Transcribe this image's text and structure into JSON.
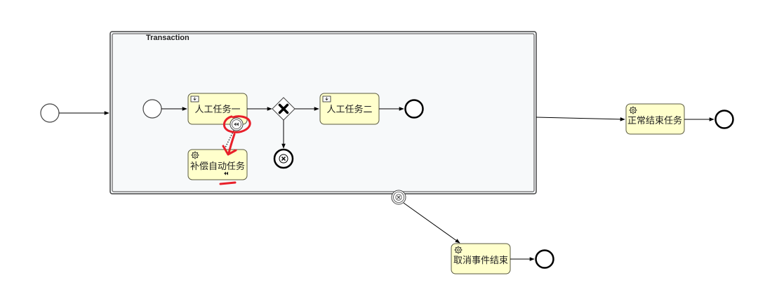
{
  "diagram": {
    "transaction_label": "Transaction",
    "tasks": {
      "user_task_1": "人工任务一",
      "user_task_2": "人工任务二",
      "compensation_task": "补偿自动任务",
      "normal_end_task": "正常结束任务",
      "cancel_end_task": "取消事件结束"
    },
    "colors": {
      "task_fill": "#ffffcc",
      "task_stroke": "#5a5a40",
      "line": "#000000",
      "annotation": "#e8202a"
    }
  }
}
